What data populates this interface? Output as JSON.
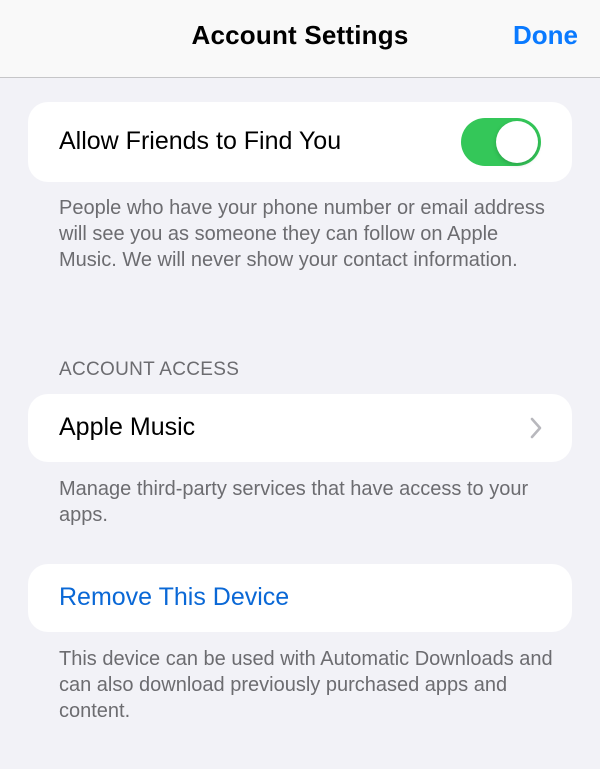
{
  "nav": {
    "title": "Account Settings",
    "done_label": "Done"
  },
  "find_friends": {
    "label": "Allow Friends to Find You",
    "toggle_on": true,
    "footer": "People who have your phone number or email address will see you as someone they can follow on Apple Music. We will never show your contact information."
  },
  "account_access": {
    "header": "ACCOUNT ACCESS",
    "item_label": "Apple Music",
    "footer": "Manage third-party services that have access to your apps."
  },
  "remove_device": {
    "label": "Remove This Device",
    "footer": "This device can be used with Automatic Downloads and can also download previously purchased apps and content."
  },
  "colors": {
    "accent": "#0a7aff",
    "toggle_on": "#34c759",
    "background": "#f2f2f7"
  },
  "icons": {
    "chevron": "chevron-right-icon"
  }
}
